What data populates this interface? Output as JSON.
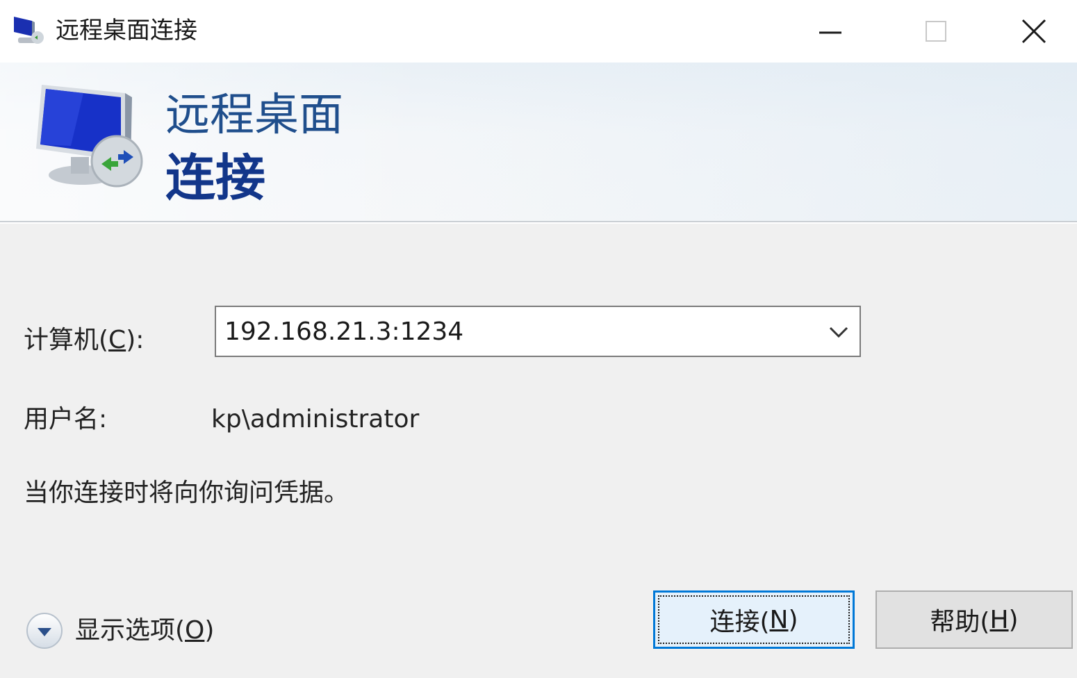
{
  "window": {
    "title": "远程桌面连接",
    "controls": {
      "minimize_icon": "minimize-icon",
      "maximize_icon": "maximize-icon",
      "close_icon": "close-icon"
    }
  },
  "banner": {
    "title_line1": "远程桌面",
    "title_line2": "连接",
    "icon": "remote-desktop-icon"
  },
  "form": {
    "computer_label_prefix": "计算机(",
    "computer_label_key": "C",
    "computer_label_suffix": "):",
    "computer_value": "192.168.21.3:1234",
    "username_label": "用户名:",
    "username_value": "kp\\administrator",
    "hint": "当你连接时将向你询问凭据。"
  },
  "footer": {
    "options_prefix": "显示选项(",
    "options_key": "O",
    "options_suffix": ")",
    "connect_prefix": "连接(",
    "connect_key": "N",
    "connect_suffix": ")",
    "help_prefix": "帮助(",
    "help_key": "H",
    "help_suffix": ")"
  },
  "colors": {
    "accent": "#0078d7",
    "banner_title": "#1f4e8c",
    "banner_title_bold": "#12368a",
    "background": "#f0f0f0"
  }
}
